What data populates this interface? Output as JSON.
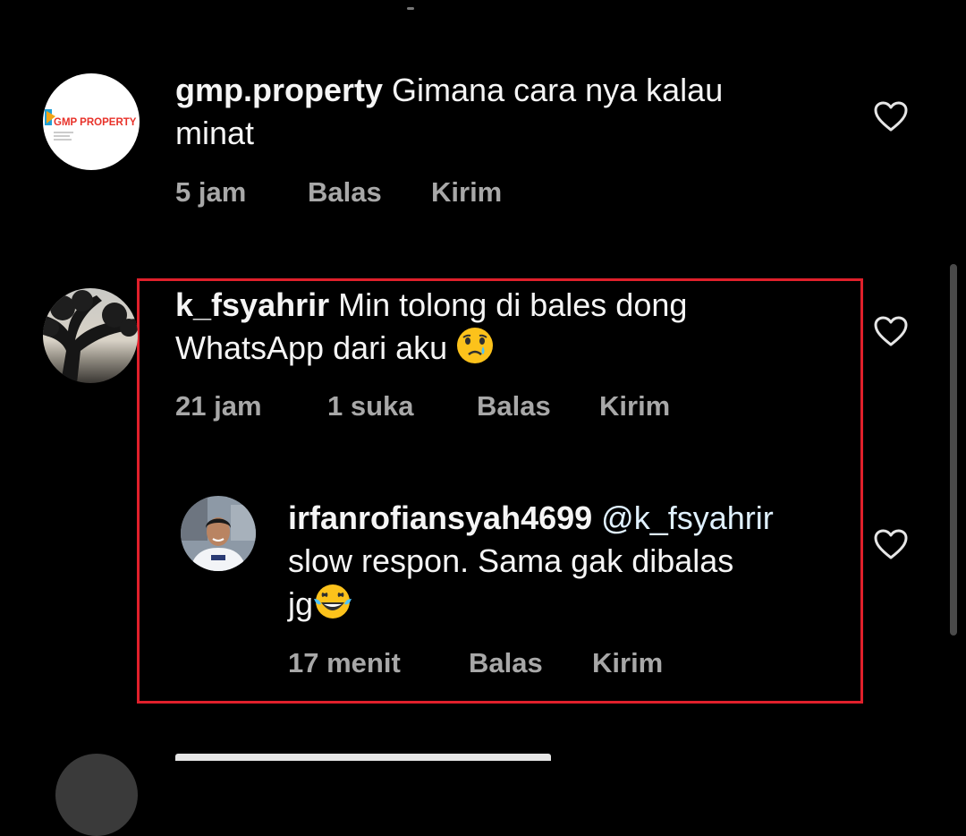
{
  "comments": [
    {
      "username": "gmp.property",
      "text": "Gimana cara nya kalau",
      "text_line2": "minat",
      "avatar_brand": "GMP PROPERTY",
      "time": "5 jam",
      "reply": "Balas",
      "send": "Kirim"
    },
    {
      "username": "k_fsyahrir",
      "text": "Min tolong di bales dong",
      "text_line2": "WhatsApp dari aku",
      "emoji": "crying-face",
      "time": "21 jam",
      "likes": "1 suka",
      "reply": "Balas",
      "send": "Kirim"
    },
    {
      "username": "irfanrofiansyah4699",
      "mention": "@k_fsyahrir",
      "text_line2": "slow respon. Sama gak dibalas",
      "text_line3": "jg",
      "emoji": "laughing-tears-face",
      "time": "17 menit",
      "reply": "Balas",
      "send": "Kirim"
    }
  ],
  "colors": {
    "background": "#000000",
    "meta_text": "#a8a8a8",
    "mention": "#e0f1ff",
    "highlight_border": "#e0202b",
    "gmp_red": "#e8322a"
  },
  "icons": [
    "heart-outline-icon",
    "crying-face-emoji",
    "laughing-tears-emoji"
  ]
}
